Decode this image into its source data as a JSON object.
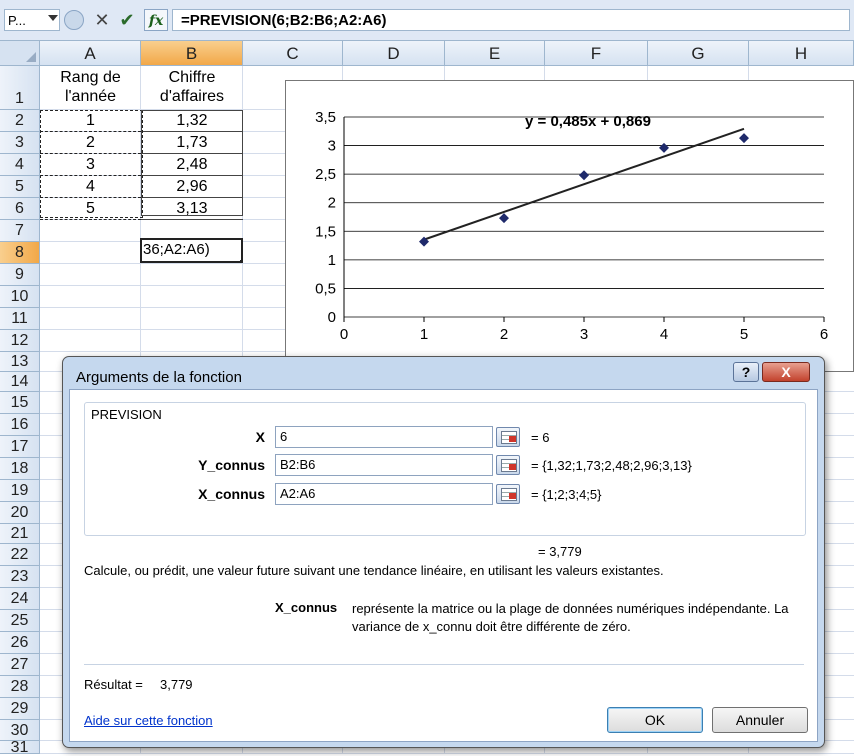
{
  "formula_bar": {
    "name_box": "P...",
    "cancel_glyph": "✕",
    "enter_glyph": "✔",
    "fx_label": "fx",
    "formula": "=PREVISION(6;B2:B6;A2:A6)"
  },
  "sheet": {
    "columns": [
      "A",
      "B",
      "C",
      "D",
      "E",
      "F",
      "G",
      "H"
    ],
    "selected_column": "B",
    "rows": [
      "1",
      "2",
      "3",
      "4",
      "5",
      "6",
      "7",
      "8",
      "9",
      "10",
      "11",
      "12",
      "13",
      "14",
      "15",
      "16",
      "17",
      "18",
      "19",
      "20",
      "21",
      "22",
      "23",
      "24",
      "25",
      "26",
      "27",
      "28",
      "29",
      "30",
      "31"
    ],
    "selected_row": "8",
    "header_a": [
      "Rang de",
      "l'année"
    ],
    "header_b": [
      "Chiffre",
      "d'affaires"
    ],
    "rank": [
      "1",
      "2",
      "3",
      "4",
      "5"
    ],
    "revenue": [
      "1,32",
      "1,73",
      "2,48",
      "2,96",
      "3,13"
    ],
    "edit_cell_text": "36;A2:A6)"
  },
  "chart_data": {
    "type": "scatter",
    "points": [
      [
        1,
        1.32
      ],
      [
        2,
        1.73
      ],
      [
        3,
        2.48
      ],
      [
        4,
        2.96
      ],
      [
        5,
        3.13
      ]
    ],
    "trendline": {
      "slope": 0.485,
      "intercept": 0.869,
      "x_range": [
        1,
        5
      ]
    },
    "trend_label": "y = 0,485x + 0,869",
    "xlim": [
      0,
      6
    ],
    "ylim": [
      0,
      3.5
    ],
    "x_ticks": [
      "0",
      "1",
      "2",
      "3",
      "4",
      "5",
      "6"
    ],
    "y_ticks": [
      "0",
      "0,5",
      "1",
      "1,5",
      "2",
      "2,5",
      "3",
      "3,5"
    ],
    "grid": "horizontal",
    "marker_color": "#1f2a6b",
    "line_color": "#222222"
  },
  "dialog": {
    "title": "Arguments de la fonction",
    "help_glyph": "?",
    "close_glyph": "X",
    "function_name": "PREVISION",
    "args": [
      {
        "label": "X",
        "value": "6",
        "result": "=  6"
      },
      {
        "label": "Y_connus",
        "value": "B2:B6",
        "result": "=  {1,32;1,73;2,48;2,96;3,13}"
      },
      {
        "label": "X_connus",
        "value": "A2:A6",
        "result": "=  {1;2;3;4;5}"
      }
    ],
    "function_result": "=  3,779",
    "description": "Calcule, ou prédit, une valeur future suivant une tendance linéaire, en utilisant les valeurs existantes.",
    "arg_name": "X_connus",
    "arg_description": "représente la matrice ou la plage de données numériques indépendante. La variance de x_connu doit être différente de zéro.",
    "result_label": "Résultat =",
    "result_value": "3,779",
    "help_link": "Aide sur cette fonction",
    "ok_label": "OK",
    "cancel_label": "Annuler"
  }
}
